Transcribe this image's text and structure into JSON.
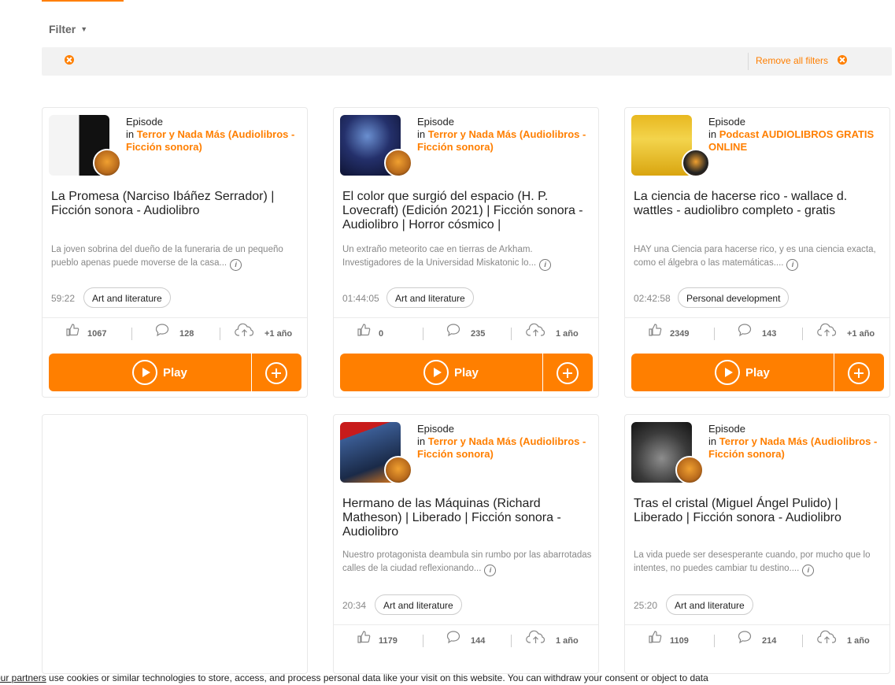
{
  "filter": {
    "label": "Filter",
    "remove_all": "Remove all filters"
  },
  "colors": {
    "accent": "#ff7f00",
    "muted": "#888888"
  },
  "episodes": [
    {
      "kind": "Episode",
      "in": "in",
      "podcast": "Terror y Nada Más (Audiolibros - Ficción sonora)",
      "title": "La Promesa (Narciso Ibáñez Serrador) | Ficción sonora - Audiolibro",
      "description": "La joven sobrina del dueño de la funeraria de un pequeño pueblo apenas puede moverse de la casa...",
      "duration": "59:22",
      "tag": "Art and literature",
      "likes": "1067",
      "comments": "128",
      "age": "+1 año"
    },
    {
      "kind": "Episode",
      "in": "in",
      "podcast": "Terror y Nada Más (Audiolibros - Ficción sonora)",
      "title": "El color que surgió del espacio (H. P. Lovecraft) (Edición 2021) | Ficción sonora - Audiolibro | Horror cósmico |",
      "description": "Un extraño meteorito cae en tierras de Arkham. Investigadores de la Universidad Miskatonic lo...",
      "duration": "01:44:05",
      "tag": "Art and literature",
      "likes": "0",
      "comments": "235",
      "age": "1 año"
    },
    {
      "kind": "Episode",
      "in": "in",
      "podcast": "Podcast AUDIOLIBROS GRATIS ONLINE",
      "title": "La ciencia de hacerse rico - wallace d. wattles - audiolibro completo - gratis",
      "description": "HAY una Ciencia para hacerse rico, y es una ciencia exacta, como el álgebra o las matemáticas....",
      "duration": "02:42:58",
      "tag": "Personal development",
      "likes": "2349",
      "comments": "143",
      "age": "+1 año"
    },
    {
      "kind": "Episode",
      "in": "in",
      "podcast": "Terror y Nada Más (Audiolibros - Ficción sonora)",
      "title": "Hermano de las Máquinas (Richard Matheson) | Liberado | Ficción sonora - Audiolibro",
      "description": "Nuestro protagonista deambula sin rumbo por las abarrotadas calles de la ciudad reflexionando...",
      "duration": "20:34",
      "tag": "Art and literature",
      "likes": "1179",
      "comments": "144",
      "age": "1 año"
    },
    {
      "kind": "Episode",
      "in": "in",
      "podcast": "Terror y Nada Más (Audiolibros - Ficción sonora)",
      "title": "Tras el cristal (Miguel Ángel Pulido) | Liberado | Ficción sonora - Audiolibro",
      "description": "La vida puede ser desesperante cuando, por mucho que lo intentes, no puedes cambiar tu destino....",
      "duration": "25:20",
      "tag": "Art and literature",
      "likes": "1109",
      "comments": "214",
      "age": "1 año"
    }
  ],
  "play_label": "Play",
  "info_glyph": "i",
  "cookie": {
    "link": "our partners",
    "text": " use cookies or similar technologies to store, access, and process personal data like your visit on this website. You can withdraw your consent or object to data"
  }
}
